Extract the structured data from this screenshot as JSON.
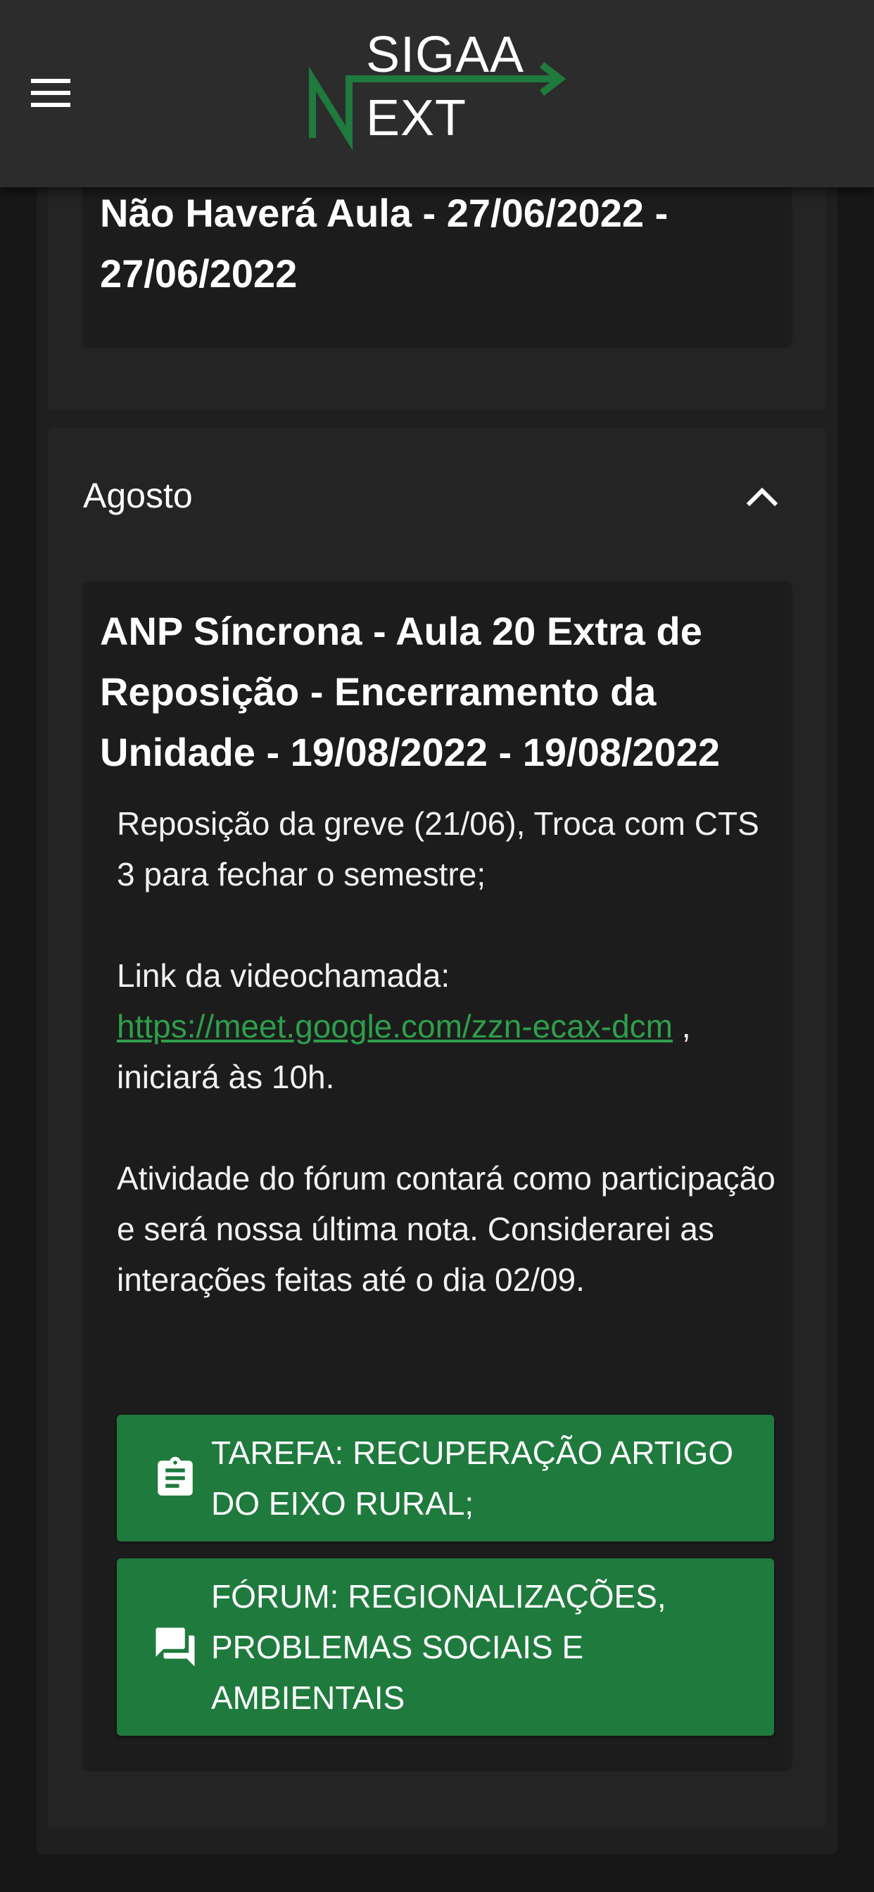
{
  "app": {
    "logo_top": "SIGAA",
    "logo_bottom": "EXT",
    "brand_color": "#1f7a3d"
  },
  "icons": {
    "menu": "hamburger-menu-icon",
    "chevron": "chevron-up-icon",
    "task": "clipboard-icon",
    "forum": "forum-chat-icon"
  },
  "prev_event": {
    "title": "Não Haverá Aula - 27/06/2022 - 27/06/2022"
  },
  "section": {
    "title": "Agosto",
    "expanded": true
  },
  "event": {
    "title": "ANP Síncrona - Aula 20 Extra de Reposição - Encerramento da Unidade - 19/08/2022 - 19/08/2022",
    "description_p1": "Reposição da greve (21/06), Troca com CTS 3 para fechar o semestre;",
    "link_prefix": "Link da videochamada:",
    "link_url": "https://meet.google.com/zzn-ecax-dcm",
    "link_suffix": ", iniciará às 10h.",
    "description_p3": "Atividade do fórum contará como participação e será nossa última nota. Considerarei as interações feitas até o dia 02/09.",
    "actions": [
      {
        "label": "TAREFA: RECUPERAÇÃO ARTIGO DO EIXO RURAL;",
        "icon": "clipboard-icon"
      },
      {
        "label": "FÓRUM: REGIONALIZAÇÕES, PROBLEMAS SOCIAIS E AMBIENTAIS",
        "icon": "forum-chat-icon"
      }
    ]
  }
}
